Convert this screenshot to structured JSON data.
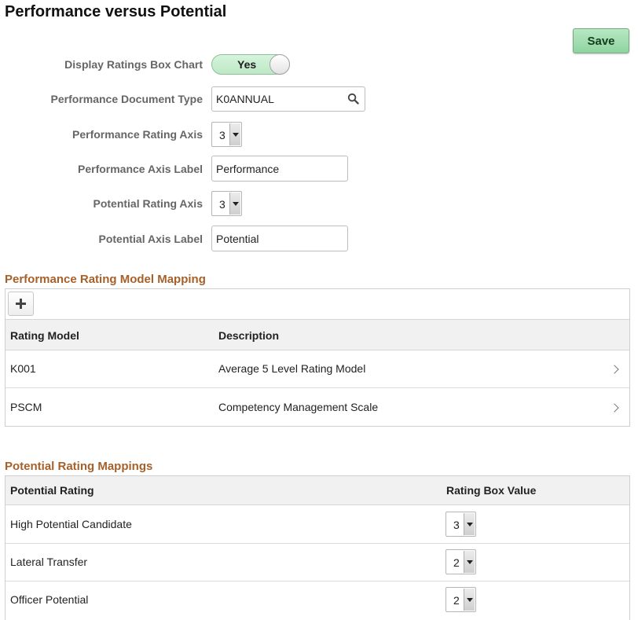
{
  "page": {
    "title": "Performance versus Potential"
  },
  "toolbar": {
    "save_label": "Save"
  },
  "form": {
    "display_chart": {
      "label": "Display Ratings Box Chart",
      "value": "Yes"
    },
    "doc_type": {
      "label": "Performance Document Type",
      "value": "K0ANNUAL",
      "icon": "search-icon"
    },
    "perf_axis": {
      "label": "Performance Rating Axis",
      "value": "3"
    },
    "perf_axis_label": {
      "label": "Performance Axis Label",
      "value": "Performance"
    },
    "pot_axis": {
      "label": "Potential Rating Axis",
      "value": "3"
    },
    "pot_axis_label": {
      "label": "Potential Axis Label",
      "value": "Potential"
    }
  },
  "perf_mapping": {
    "title": "Performance Rating Model Mapping",
    "columns": [
      "Rating Model",
      "Description"
    ],
    "rows": [
      {
        "model": "K001",
        "description": "Average 5 Level Rating Model"
      },
      {
        "model": "PSCM",
        "description": "Competency Management Scale"
      }
    ]
  },
  "pot_mapping": {
    "title": "Potential Rating Mappings",
    "columns": [
      "Potential Rating",
      "Rating Box Value"
    ],
    "rows": [
      {
        "rating": "High Potential Candidate",
        "value": "3"
      },
      {
        "rating": "Lateral Transfer",
        "value": "2"
      },
      {
        "rating": "Officer Potential",
        "value": "2"
      }
    ]
  }
}
